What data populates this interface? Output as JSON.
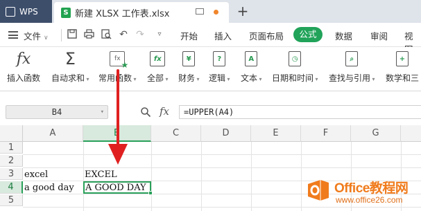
{
  "titlebar": {
    "app_tab": "WPS",
    "file_tab": "新建 XLSX 工作表.xlsx",
    "new_tab": "+"
  },
  "menubar": {
    "file_menu": "文件",
    "tabs": [
      "开始",
      "插入",
      "页面布局",
      "公式",
      "数据",
      "审阅",
      "视图"
    ],
    "active_tab": "公式"
  },
  "ribbon": {
    "buttons": [
      {
        "label": "插入函数",
        "icon": "fx-icon"
      },
      {
        "label": "自动求和",
        "icon": "sigma-icon"
      },
      {
        "label": "常用函数",
        "icon": "common-functions-icon"
      },
      {
        "label": "全部",
        "icon": "fx-book-icon"
      },
      {
        "label": "财务",
        "icon": "finance-book-icon"
      },
      {
        "label": "逻辑",
        "icon": "logic-book-icon"
      },
      {
        "label": "文本",
        "icon": "text-book-icon"
      },
      {
        "label": "日期和时间",
        "icon": "datetime-book-icon"
      },
      {
        "label": "查找与引用",
        "icon": "lookup-book-icon"
      },
      {
        "label": "数学和三",
        "icon": "math-book-icon"
      }
    ]
  },
  "formula_bar": {
    "name_box": "B4",
    "fx": "fx",
    "formula": "=UPPER(A4)"
  },
  "sheet": {
    "columns": [
      "A",
      "B",
      "C",
      "D",
      "E",
      "F",
      "G"
    ],
    "selected_column": "B",
    "rows": [
      "1",
      "2",
      "3",
      "4",
      "5"
    ],
    "selected_row": "4",
    "cells": {
      "A3": "excel",
      "B3": "EXCEL",
      "A4": "a good day",
      "B4": "A GOOD DAY"
    }
  },
  "watermark": {
    "brand": "Office教程网",
    "url": "www.office26.com"
  },
  "colors": {
    "accent_green": "#21a35a",
    "arrow_red": "#e02020",
    "watermark_orange": "#f07b1c"
  }
}
